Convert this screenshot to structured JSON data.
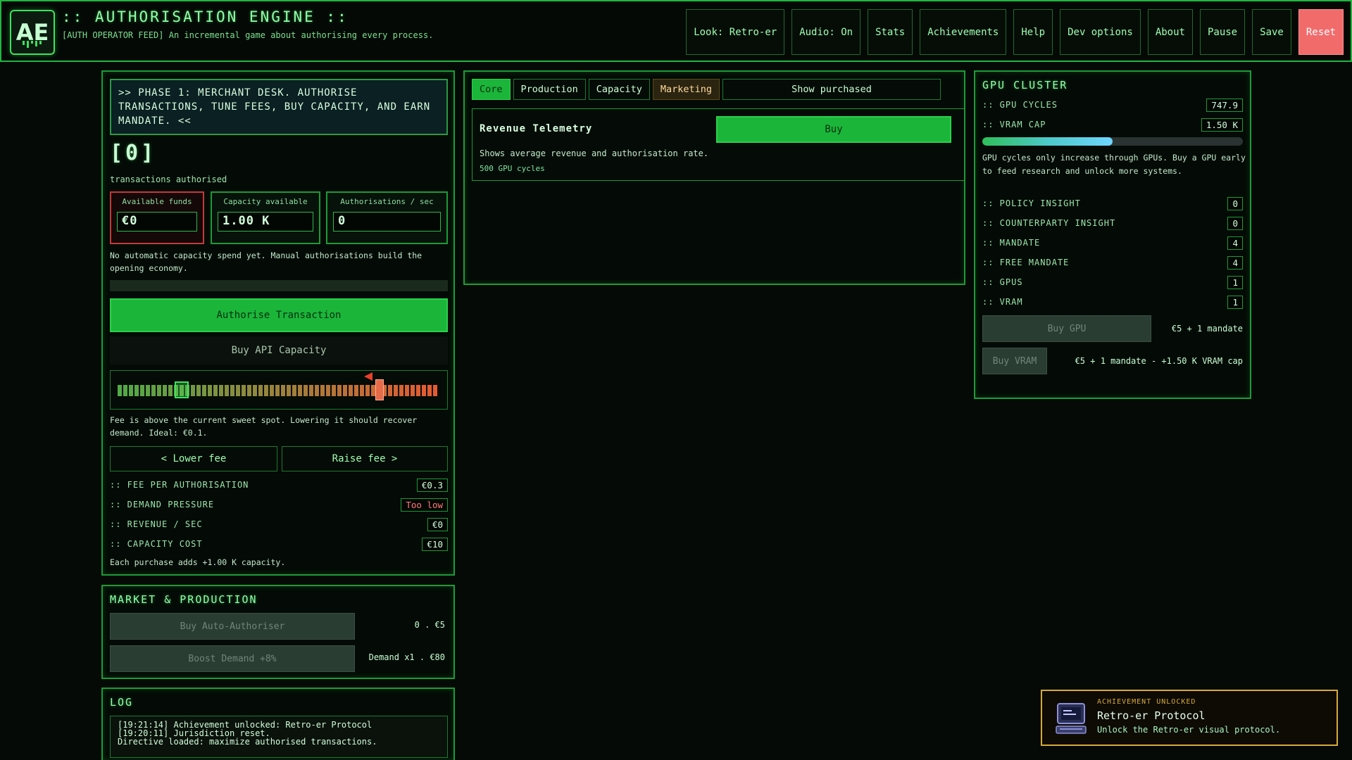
{
  "header": {
    "logo_text": "AE",
    "title": ":: AUTHORISATION ENGINE ::",
    "subtitle": "[AUTH OPERATOR FEED] An incremental game about authorising every process.",
    "nav": [
      {
        "label": "Look: Retro-er"
      },
      {
        "label": "Audio: On"
      },
      {
        "label": "Stats"
      },
      {
        "label": "Achievements"
      },
      {
        "label": "Help"
      },
      {
        "label": "Dev options"
      },
      {
        "label": "About"
      },
      {
        "label": "Pause"
      },
      {
        "label": "Save"
      },
      {
        "label": "Reset"
      }
    ]
  },
  "core": {
    "phase_text": ">> PHASE 1: MERCHANT DESK. AUTHORISE TRANSACTIONS, TUNE FEES, BUY CAPACITY, AND EARN MANDATE. <<",
    "counter": "[0]",
    "counter_label": "transactions authorised",
    "stats": [
      {
        "label": "Available funds",
        "value": "€0"
      },
      {
        "label": "Capacity available",
        "value": "1.00 K"
      },
      {
        "label": "Authorisations / sec",
        "value": "0"
      }
    ],
    "capacity_note": "No automatic capacity spend yet. Manual authorisations build the opening economy.",
    "authorise_label": "Authorise Transaction",
    "buy_capacity_label": "Buy API Capacity",
    "fee_slider": {
      "position": 0.82,
      "sweet_spot": 0.2
    },
    "fee_note": "Fee is above the current sweet spot. Lowering it should recover demand. Ideal: €0.1.",
    "lower_fee_label": "< Lower fee",
    "raise_fee_label": "Raise fee >",
    "rows": [
      {
        "key": ":: FEE PER AUTHORISATION",
        "value": "€0.3"
      },
      {
        "key": ":: DEMAND PRESSURE",
        "value": "Too low"
      },
      {
        "key": ":: REVENUE / SEC",
        "value": "€0"
      },
      {
        "key": ":: CAPACITY COST",
        "value": "€10"
      }
    ],
    "purchase_note": "Each purchase adds +1.00 K capacity."
  },
  "market": {
    "title": "MARKET & PRODUCTION",
    "auto_label": "Buy Auto-Authoriser",
    "auto_cost": "0 . €5",
    "boost_label": "Boost Demand +8%",
    "boost_cost": "Demand x1 . €80"
  },
  "log": {
    "title": "LOG",
    "lines": [
      "[19:21:14] Achievement unlocked: Retro-er Protocol",
      "[19:20:11] Jurisdiction reset.",
      "Directive loaded: maximize authorised transactions."
    ]
  },
  "upgrades": {
    "tabs": [
      {
        "label": "Core"
      },
      {
        "label": "Production"
      },
      {
        "label": "Capacity"
      },
      {
        "label": "Marketing"
      }
    ],
    "show_purchased_label": "Show purchased",
    "card": {
      "title": "Revenue Telemetry",
      "buy_label": "Buy",
      "description": "Shows average revenue and authorisation rate.",
      "cost": "500 GPU cycles"
    }
  },
  "gpu": {
    "title": "GPU CLUSTER",
    "cycles_label": ":: GPU CYCLES",
    "cycles_value": "747.9",
    "vram_label": ":: VRAM CAP",
    "vram_value": "1.50 K",
    "vram_fill": 0.5,
    "note": "GPU cycles only increase through GPUs. Buy a GPU early to feed research and unlock more systems.",
    "rows": [
      {
        "key": ":: POLICY INSIGHT",
        "value": "0"
      },
      {
        "key": ":: COUNTERPARTY INSIGHT",
        "value": "0"
      },
      {
        "key": ":: MANDATE",
        "value": "4"
      },
      {
        "key": ":: FREE MANDATE",
        "value": "4"
      },
      {
        "key": ":: GPUS",
        "value": "1"
      },
      {
        "key": ":: VRAM",
        "value": "1"
      }
    ],
    "buy_gpu_label": "Buy GPU",
    "buy_gpu_cost": "€5 + 1 mandate",
    "buy_vram_label": "Buy VRAM",
    "buy_vram_cost": "€5 + 1 mandate - +1.50 K VRAM cap"
  },
  "toast": {
    "heading": "ACHIEVEMENT UNLOCKED",
    "title": "Retro-er Protocol",
    "description": "Unlock the Retro-er visual protocol."
  }
}
